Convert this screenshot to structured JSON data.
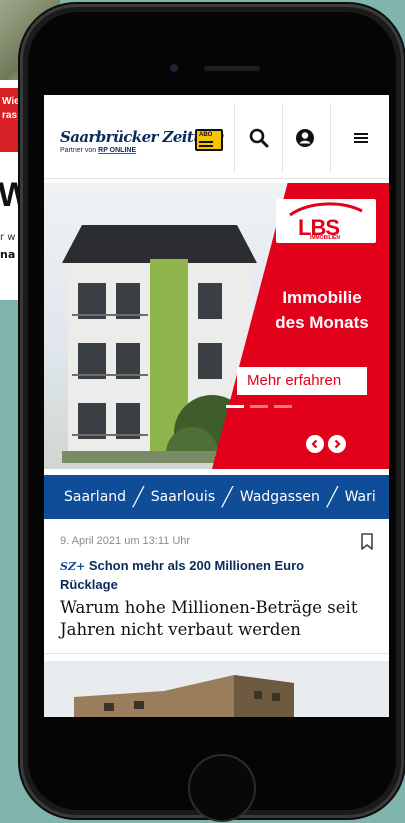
{
  "background_page": {
    "red_lines": [
      "Wie",
      "ras"
    ],
    "big_letter": "W",
    "small_text": "r w",
    "small_bold": "na"
  },
  "header": {
    "logo_title": "Saarbrücker Zeitung",
    "logo_partner_prefix": "Partner von ",
    "logo_partner_brand": "RP ONLINE",
    "abo_label": "ABO"
  },
  "hero": {
    "brand": "LBS",
    "brand_sub": "IMMOBILIEN",
    "title_line1": "Immobilie",
    "title_line2": "des Monats",
    "cta_label": "Mehr erfahren"
  },
  "breadcrumb": {
    "items": [
      "Saarland",
      "Saarlouis",
      "Wadgassen",
      "Wari"
    ]
  },
  "article": {
    "date": "9. April 2021 um 13:11 Uhr",
    "premium_mark": "SZ+",
    "kicker": "Schon mehr als 200 Millionen Euro Rücklage",
    "headline": "Warum hohe Millionen-Beträge seit Jahren nicht verbaut werden"
  },
  "colors": {
    "page_bg": "#7fb5ad",
    "brand_blue": "#0f4d98",
    "lbs_red": "#e2001a",
    "abo_yellow": "#f7c400"
  }
}
